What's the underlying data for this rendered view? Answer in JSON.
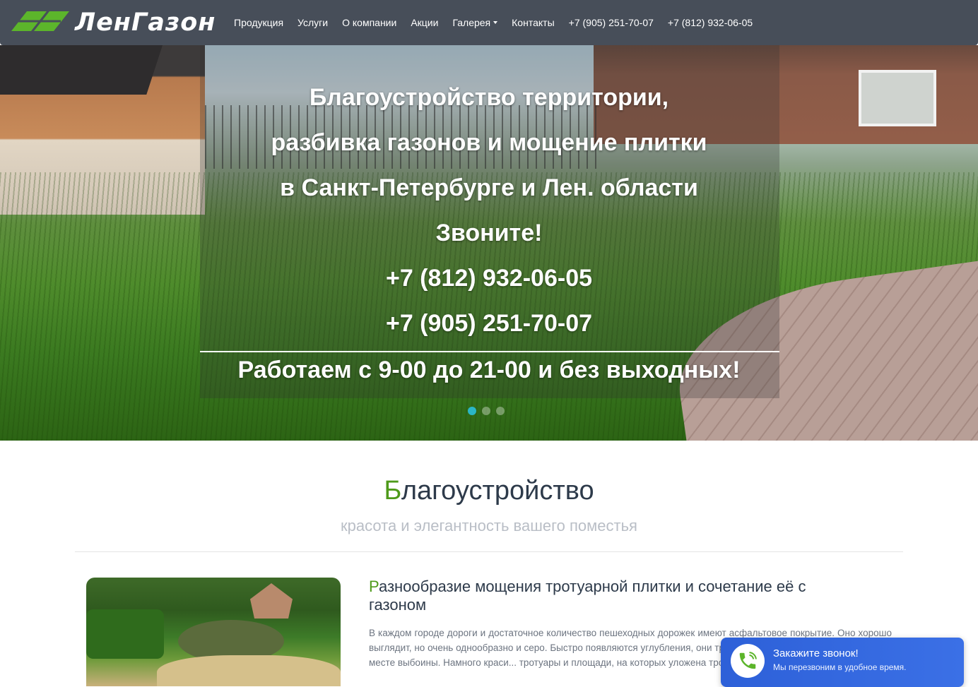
{
  "brand": {
    "logo_text": "ЛенГазон",
    "accent_color": "#5cb52b"
  },
  "nav": {
    "items": [
      {
        "label": "Продукция"
      },
      {
        "label": "Услуги"
      },
      {
        "label": "О компании"
      },
      {
        "label": "Акции"
      },
      {
        "label": "Галерея",
        "dropdown": true
      },
      {
        "label": "Контакты"
      },
      {
        "label": "+7 (905) 251-70-07"
      },
      {
        "label": "+7 (812) 932-06-05"
      }
    ]
  },
  "hero": {
    "lines": [
      "Благоустройство территории,",
      "разбивка газонов и мощение плитки",
      "в Санкт-Петербурге и Лен. области",
      "Звоните!",
      "+7 (812) 932-06-05",
      "+7 (905) 251-70-07"
    ],
    "hours": "Работаем с 9-00 до 21-00 и без выходных!",
    "slides": 3,
    "active_slide": 1
  },
  "section": {
    "title_first": "Б",
    "title_rest": "лагоустройство",
    "subtitle": "красота и элегантность вашего поместья"
  },
  "article": {
    "title_first": "Р",
    "title_rest": "азнообразие мощения тротуарной плитки и сочетание её с газоном",
    "body": "В каждом городе дороги и достаточное количество пешеходных дорожек имеют асфальтовое покрытие. Оно хорошо выглядит, но очень однообразно и серо. Быстро появляются углубления, они трескаются, и вскоре мы видим на этом месте выбоины. Намного краси... тротуары и площади, на которых уложена тротуарная плитка. Та..."
  },
  "callback": {
    "title": "Закажите звонок!",
    "subtitle": "Мы перезвоним в удобное время."
  }
}
